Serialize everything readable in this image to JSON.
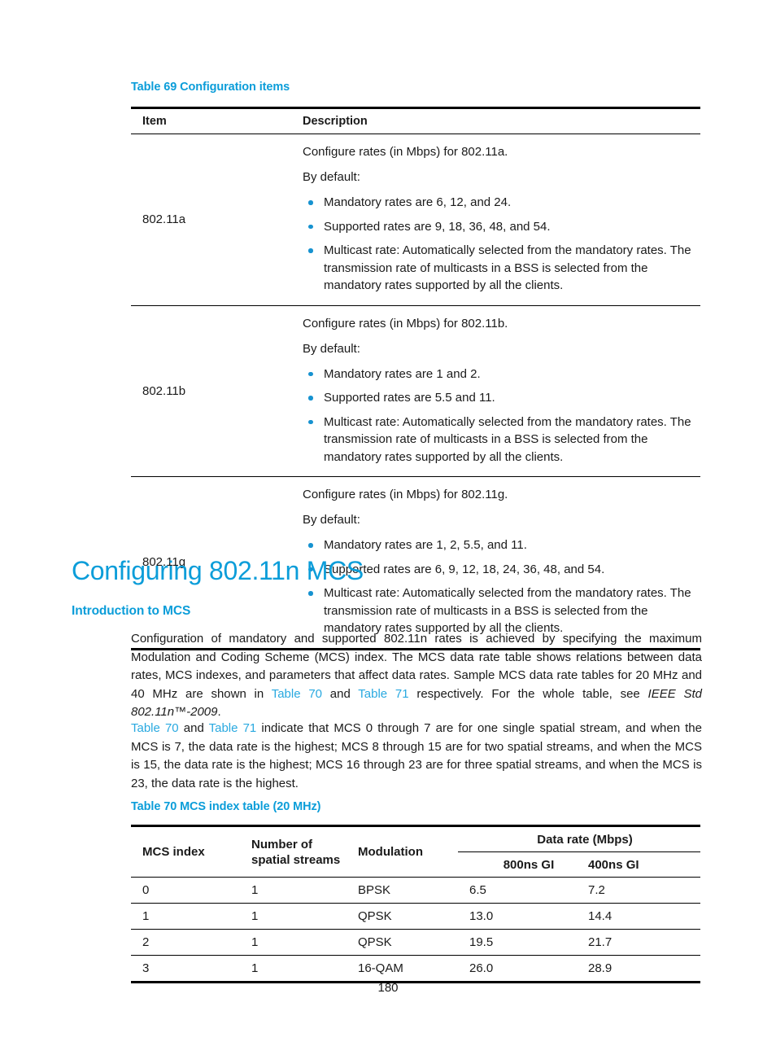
{
  "page": {
    "number": "180",
    "accent_color": "#0b9dd9",
    "link_color": "#29a9e0",
    "bullet_color": "#1692d0"
  },
  "table69": {
    "caption": "Table 69 Configuration items",
    "headers": {
      "item": "Item",
      "description": "Description"
    },
    "rows": [
      {
        "item": "802.11a",
        "intro": "Configure rates (in Mbps) for 802.11a.",
        "bydefault": "By default:",
        "bullets": [
          "Mandatory rates are 6, 12, and 24.",
          "Supported rates are 9, 18, 36, 48, and 54.",
          "Multicast rate: Automatically selected from the mandatory rates. The transmission rate of multicasts in a BSS is selected from the mandatory rates supported by all the clients."
        ]
      },
      {
        "item": "802.11b",
        "intro": "Configure rates (in Mbps) for 802.11b.",
        "bydefault": "By default:",
        "bullets": [
          "Mandatory rates are 1 and 2.",
          "Supported rates are 5.5 and 11.",
          "Multicast rate: Automatically selected from the mandatory rates. The transmission rate of multicasts in a BSS is selected from the mandatory rates supported by all the clients."
        ]
      },
      {
        "item": "802.11g",
        "intro": "Configure rates (in Mbps) for 802.11g.",
        "bydefault": "By default:",
        "bullets": [
          "Mandatory rates are 1, 2, 5.5, and 11.",
          "Supported rates are 6, 9, 12, 18, 24, 36, 48, and 54.",
          "Multicast rate: Automatically selected from the mandatory rates. The transmission rate of multicasts in a BSS is selected from the mandatory rates supported by all the clients."
        ]
      }
    ]
  },
  "section": {
    "heading": "Configuring 802.11n MCS",
    "subheading": "Introduction to MCS",
    "para1": {
      "part1": "Configuration of mandatory and supported 802.11n rates is achieved by specifying the maximum Modulation and Coding Scheme (MCS) index. The MCS data rate table shows relations between data rates, MCS indexes, and parameters that affect data rates. Sample MCS data rate tables for 20 MHz and 40 MHz are shown in ",
      "link1": "Table 70",
      "part2": " and ",
      "link2": "Table 71",
      "part3": " respectively. For the whole table, see ",
      "italic1": "IEEE Std 802.11n™-2009",
      "part4": "."
    },
    "para2": {
      "link1": "Table 70",
      "part1": " and ",
      "link2": "Table 71",
      "part2": " indicate that MCS 0 through 7 are for one single spatial stream, and when the MCS is 7, the data rate is the highest; MCS 8 through 15 are for two spatial streams, and when the MCS is 15, the data rate is the highest; MCS 16 through 23 are for three spatial streams, and when the MCS is 23, the data rate is the highest."
    }
  },
  "table70": {
    "caption": "Table 70 MCS index table (20 MHz)",
    "headers": {
      "mcs_index": "MCS index",
      "spatial_streams": "Number of spatial streams",
      "spatial_streams_line1": "Number of",
      "spatial_streams_line2": "spatial streams",
      "modulation": "Modulation",
      "data_rate_group": "Data rate (Mbps)",
      "gi_800": "800ns GI",
      "gi_400": "400ns GI"
    },
    "rows": [
      {
        "mcs": "0",
        "streams": "1",
        "modulation": "BPSK",
        "gi800": "6.5",
        "gi400": "7.2"
      },
      {
        "mcs": "1",
        "streams": "1",
        "modulation": "QPSK",
        "gi800": "13.0",
        "gi400": "14.4"
      },
      {
        "mcs": "2",
        "streams": "1",
        "modulation": "QPSK",
        "gi800": "19.5",
        "gi400": "21.7"
      },
      {
        "mcs": "3",
        "streams": "1",
        "modulation": "16-QAM",
        "gi800": "26.0",
        "gi400": "28.9"
      }
    ]
  }
}
